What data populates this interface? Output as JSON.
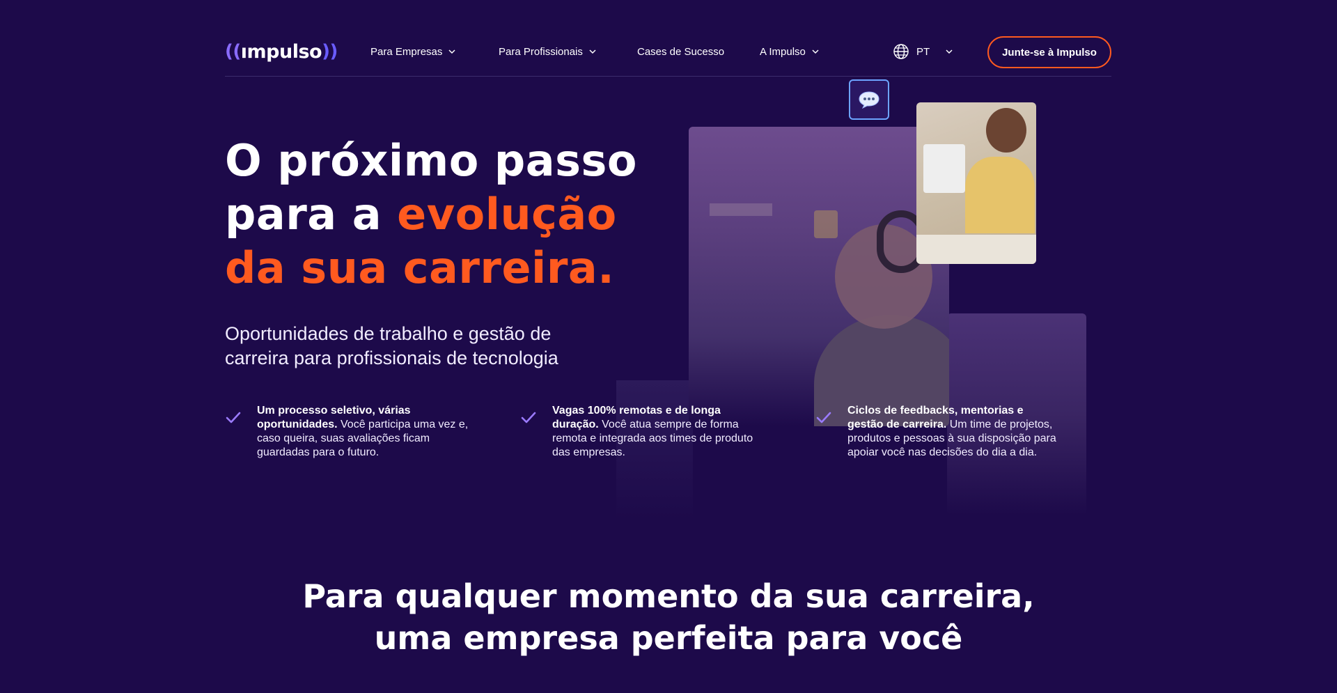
{
  "header": {
    "logo": {
      "left_wave": "((",
      "text": "ımpulso",
      "right_wave": "))"
    },
    "nav": [
      {
        "label": "Para Empresas",
        "has_dropdown": true
      },
      {
        "label": "Para Profissionais",
        "has_dropdown": true
      },
      {
        "label": "Cases de Sucesso",
        "has_dropdown": false
      },
      {
        "label": "A Impulso",
        "has_dropdown": true
      }
    ],
    "language": {
      "label": "PT",
      "icon": "globe-icon"
    },
    "cta_label": "Junte-se à Impulso"
  },
  "hero": {
    "title_line1": "O próximo passo",
    "title_line2_prefix": "para a ",
    "title_line2_accent": "evolução",
    "title_line3": "da sua carreira.",
    "subtitle": "Oportunidades de trabalho e gestão de carreira para profissionais de tecnologia"
  },
  "features": [
    {
      "bold": "Um processo seletivo, várias oportunidades.",
      "text": " Você participa uma vez e, caso queira, suas avaliações ficam guardadas para o futuro."
    },
    {
      "bold": "Vagas 100% remotas e de longa duração.",
      "text": " Você atua sempre de forma remota e integrada aos times de produto das empresas."
    },
    {
      "bold": "Ciclos de feedbacks, mentorias e gestão de carreira.",
      "text": " Um time de projetos, produtos e pessoas à sua disposição para apoiar você nas decisões do dia a dia."
    }
  ],
  "section": {
    "title_line1": "Para qualquer momento da sua carreira,",
    "title_line2": "uma empresa perfeita para você"
  },
  "colors": {
    "background": "#1d0a4a",
    "accent": "#ff5a1f",
    "check": "#9b7bff",
    "chat_border": "#6da4ff"
  }
}
